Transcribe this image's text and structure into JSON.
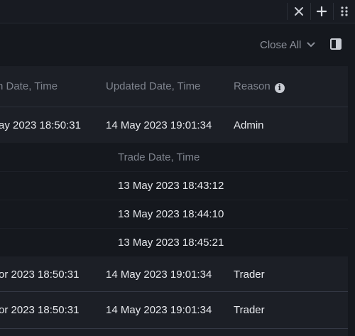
{
  "window": {
    "icons": [
      "close-icon",
      "plus-icon",
      "drag-handle-icon"
    ]
  },
  "toolbar": {
    "close_all_label": "Close All"
  },
  "table": {
    "headers": {
      "created": "n Date, Time",
      "updated": "Updated Date, Time",
      "reason": "Reason"
    },
    "rows": [
      {
        "created": "ay 2023 18:50:31",
        "updated": "14 May 2023 19:01:34",
        "reason": "Admin"
      },
      {
        "created": "or 2023 18:50:31",
        "updated": "14 May 2023 19:01:34",
        "reason": "Trader"
      },
      {
        "created": "or 2023 18:50:31",
        "updated": "14 May 2023 19:01:34",
        "reason": "Trader"
      }
    ],
    "trades": {
      "header": "Trade Date, Time",
      "items": [
        "13 May 2023 18:43:12",
        "13 May 2023 18:44:10",
        "13 May 2023 18:45:21"
      ]
    }
  }
}
